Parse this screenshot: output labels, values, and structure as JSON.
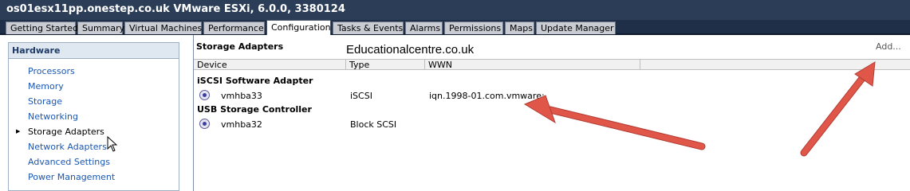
{
  "window": {
    "title": "os01esx11pp.onestep.co.uk VMware ESXi, 6.0.0, 3380124"
  },
  "tabs": [
    {
      "label": "Getting Started"
    },
    {
      "label": "Summary"
    },
    {
      "label": "Virtual Machines"
    },
    {
      "label": "Performance"
    },
    {
      "label": "Configuration",
      "active": true
    },
    {
      "label": "Tasks & Events"
    },
    {
      "label": "Alarms"
    },
    {
      "label": "Permissions"
    },
    {
      "label": "Maps"
    },
    {
      "label": "Update Manager"
    }
  ],
  "hardware": {
    "header": "Hardware",
    "items": [
      {
        "label": "Processors"
      },
      {
        "label": "Memory"
      },
      {
        "label": "Storage"
      },
      {
        "label": "Networking"
      },
      {
        "label": "Storage Adapters",
        "selected": true
      },
      {
        "label": "Network Adapters"
      },
      {
        "label": "Advanced Settings"
      },
      {
        "label": "Power Management"
      }
    ]
  },
  "storage_adapters": {
    "title": "Storage Adapters",
    "add_label": "Add...",
    "columns": [
      "Device",
      "Type",
      "WWN"
    ],
    "groups": [
      {
        "name": "iSCSI Software Adapter",
        "rows": [
          {
            "device": "vmhba33",
            "type": "iSCSI",
            "wwn": "iqn.1998-01.com.vmware:"
          }
        ]
      },
      {
        "name": "USB Storage Controller",
        "rows": [
          {
            "device": "vmhba32",
            "type": "Block SCSI",
            "wwn": ""
          }
        ]
      }
    ]
  },
  "watermark": "Educationalcentre.co.uk",
  "colors": {
    "title_bar": "#2b3d57",
    "tab_strip": "#1f2f47",
    "link": "#1a57b3",
    "arrow": "#e0574a"
  }
}
